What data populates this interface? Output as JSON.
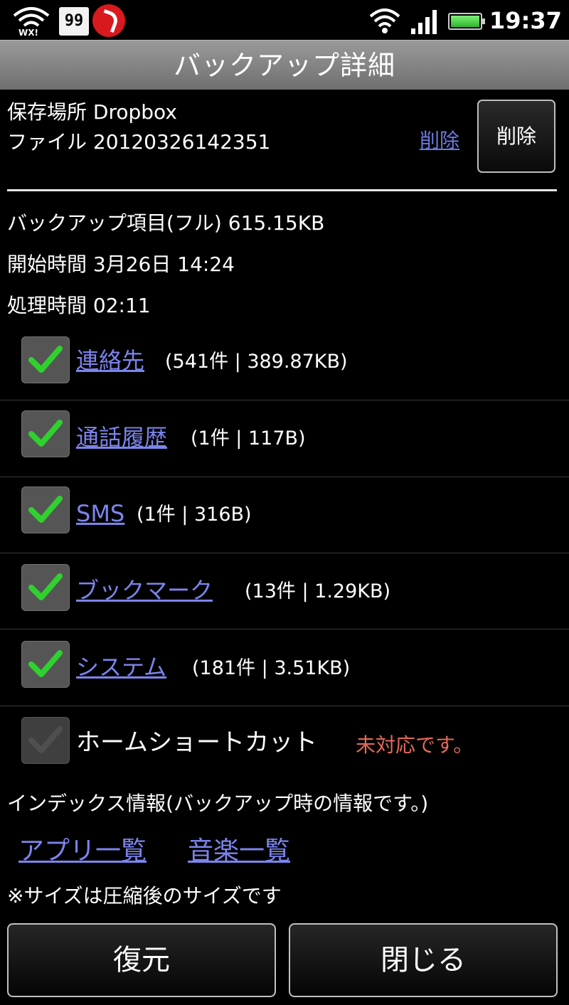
{
  "status_bar": {
    "left_icons": [
      "wifi-plus-icon",
      "99-badge-icon",
      "trend-micro-icon"
    ],
    "badge_text": "99",
    "right_icons": [
      "wifi-icon",
      "signal-icon",
      "battery-icon"
    ],
    "time": "19:37"
  },
  "header": {
    "title": "バックアップ詳細"
  },
  "details": {
    "location_label": "保存場所",
    "location_value": "Dropbox",
    "file_label": "ファイル",
    "file_value": "20120326142351",
    "delete_link": "削除",
    "delete_button": "削除",
    "backup_items_label": "バックアップ項目(フル)",
    "backup_items_size": "615.15KB",
    "start_label": "開始時間",
    "start_value": "3月26日 14:24",
    "duration_label": "処理時間",
    "duration_value": "02:11"
  },
  "items": [
    {
      "name": "連絡先",
      "info": "(541件 | 389.87KB)",
      "checked": true
    },
    {
      "name": "通話履歴",
      "info": "(1件 | 117B)",
      "checked": true
    },
    {
      "name": "SMS",
      "info": "(1件 | 316B)",
      "checked": true
    },
    {
      "name": "ブックマーク",
      "info": "(13件 | 1.29KB)",
      "checked": true
    },
    {
      "name": "システム",
      "info": "(181件 | 3.51KB)",
      "checked": true
    }
  ],
  "home_shortcut": {
    "name": "ホームショートカット",
    "note": "未対応です。",
    "checked": true,
    "disabled": true
  },
  "index": {
    "label": "インデックス情報(バックアップ時の情報です。)",
    "app_list": "アプリ一覧",
    "music_list": "音楽一覧"
  },
  "note": "※サイズは圧縮後のサイズです",
  "footer": {
    "restore": "復元",
    "close": "閉じる"
  },
  "colors": {
    "link": "#7c84ec",
    "check": "#2fd12f",
    "warning": "#e46a5c",
    "title_bar": "#888888"
  }
}
